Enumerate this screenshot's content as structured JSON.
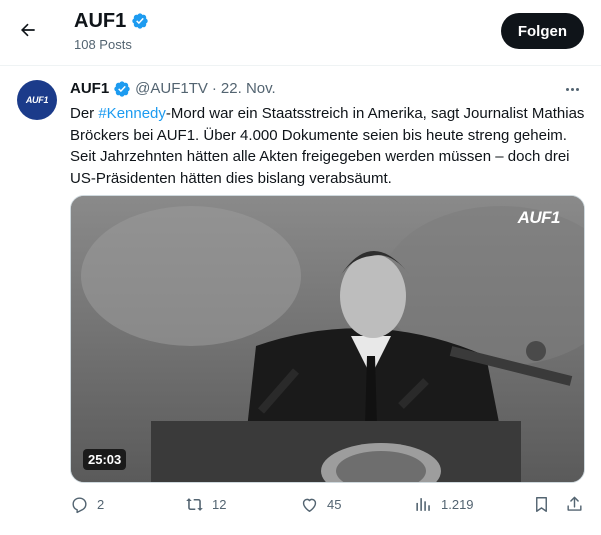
{
  "header": {
    "back_icon": "arrow-left-icon",
    "title": "AUF1",
    "post_count": "108 Posts",
    "follow_label": "Folgen"
  },
  "post": {
    "avatar_text": "AUF1",
    "author": "AUF1",
    "handle": "@AUF1TV",
    "separator": "·",
    "date": "22. Nov.",
    "text_before": "Der ",
    "hashtag": "#Kennedy",
    "text_after": "-Mord war ein Staatsstreich in Amerika, sagt Journalist Mathias Bröckers bei AUF1. Über 4.000 Dokumente seien bis heute streng geheim. Seit Jahrzehnten hätten alle Akten freigegeben werden müssen – doch drei US-Präsidenten hätten dies bislang verabsäumt.",
    "media": {
      "logo_text": "AUF1",
      "duration": "25:03"
    },
    "actions": {
      "replies": "2",
      "reposts": "12",
      "likes": "45",
      "views": "1.219"
    }
  },
  "colors": {
    "accent": "#1d9bf0",
    "text_primary": "#0f1419",
    "text_secondary": "#536471",
    "follow_bg": "#0f1419",
    "avatar_bg": "#1b3b8a"
  }
}
